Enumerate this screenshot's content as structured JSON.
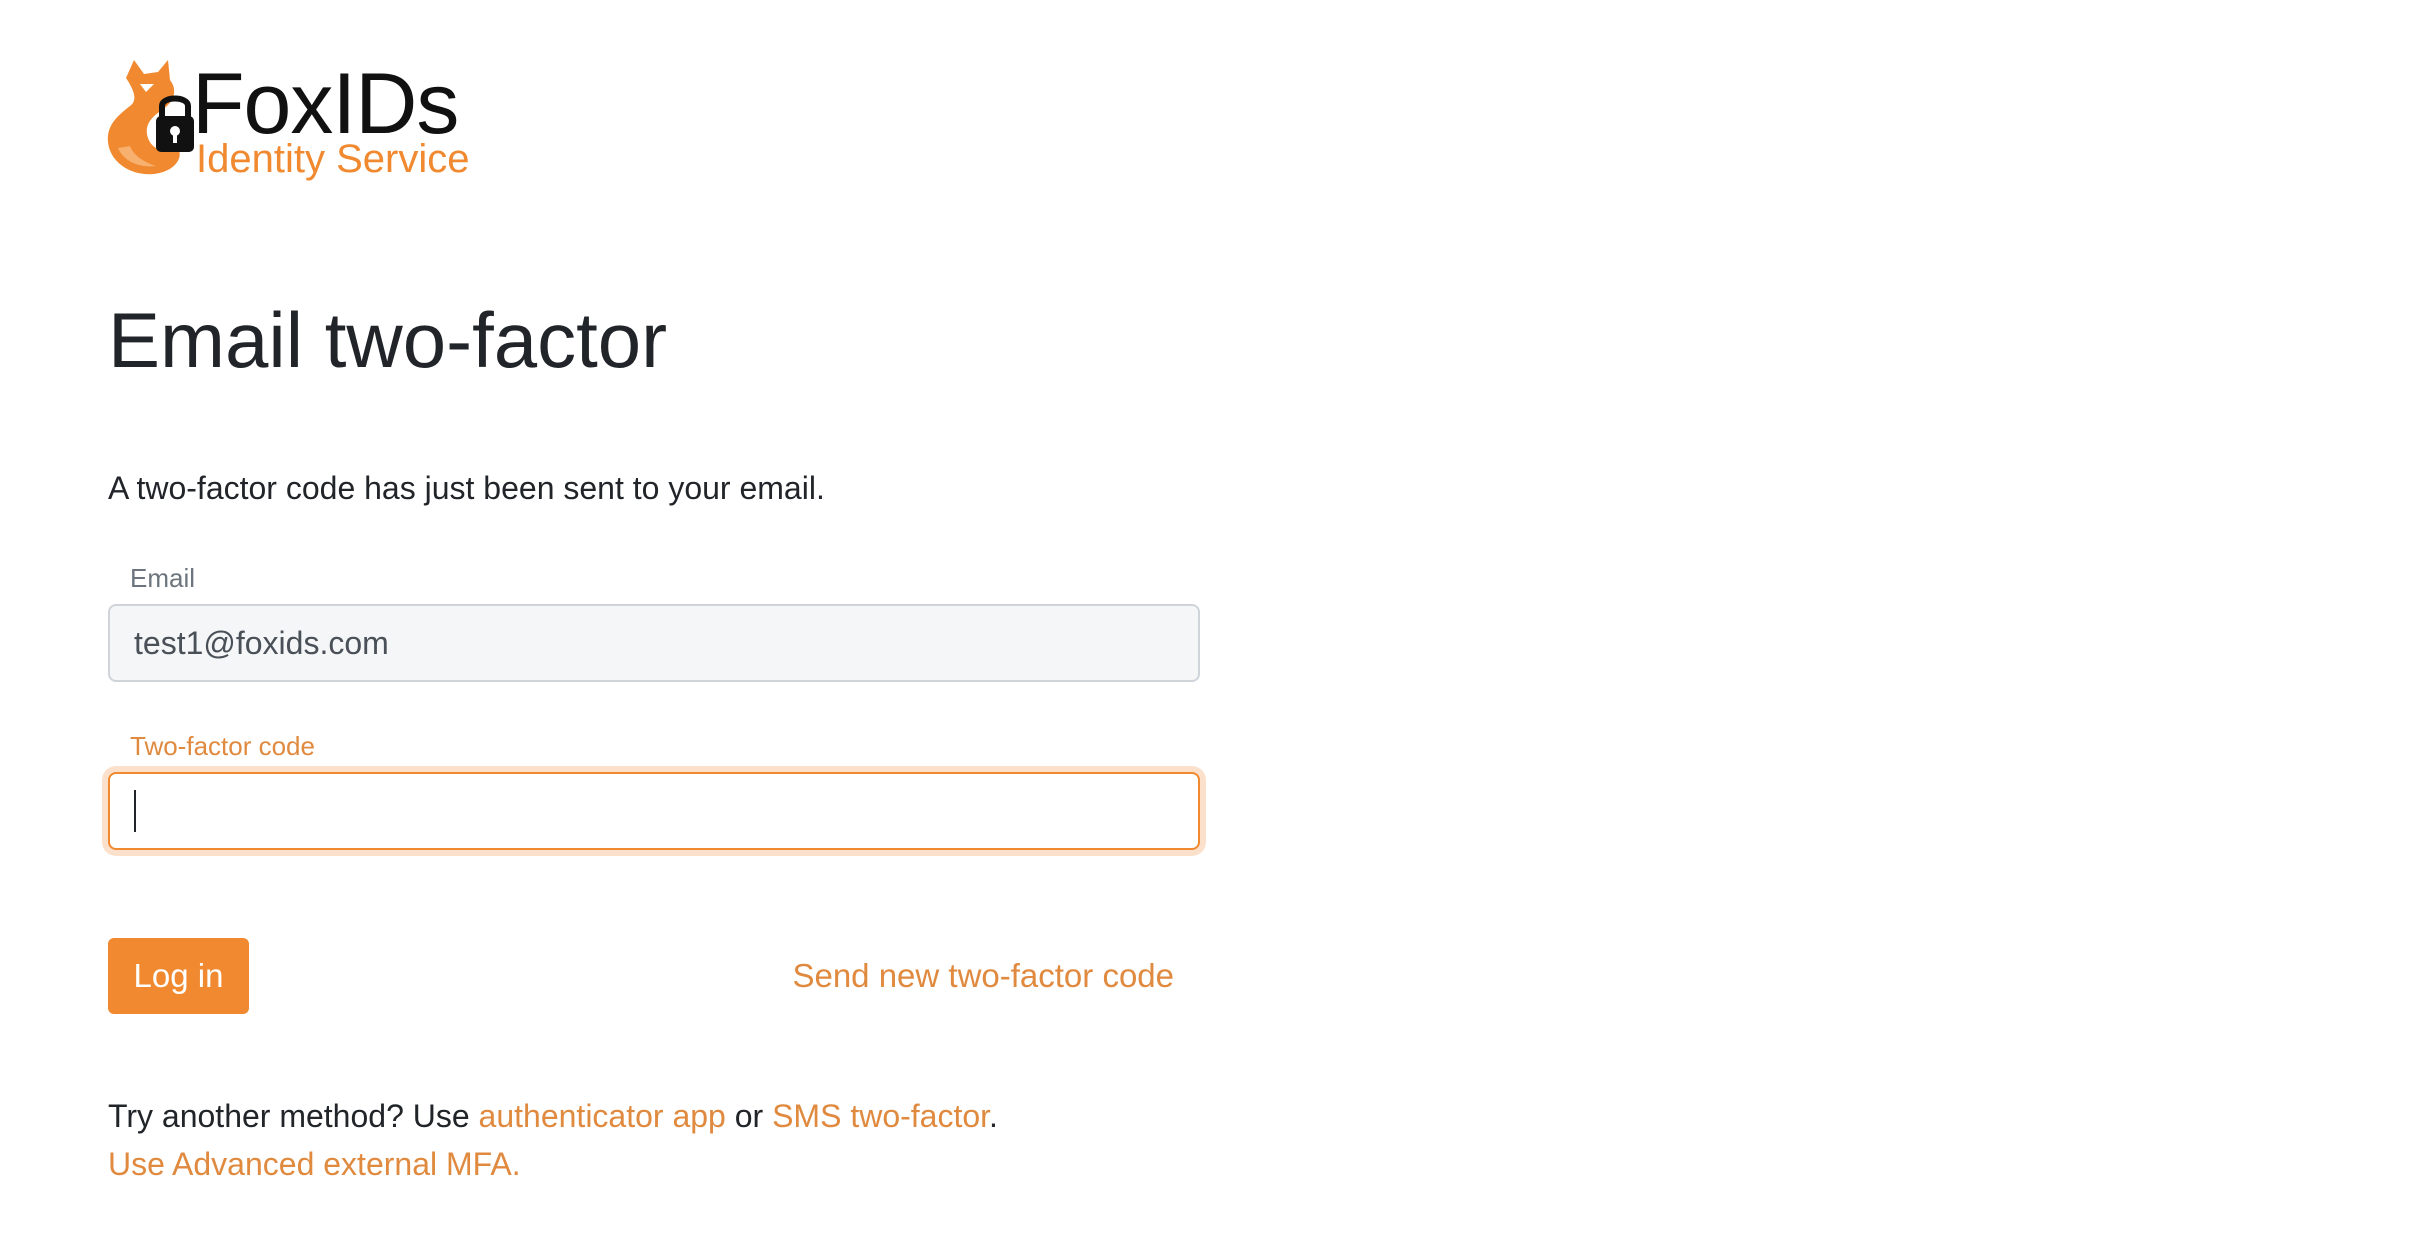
{
  "brand": {
    "name": "FoxIDs",
    "tagline": "Identity Service",
    "logo_icon": "fox-lock-icon",
    "accent_color": "#f0892f"
  },
  "page": {
    "title": "Email two-factor",
    "intro": "A two-factor code has just been sent to your email."
  },
  "form": {
    "email": {
      "label": "Email",
      "value": "test1@foxids.com"
    },
    "code": {
      "label": "Two-factor code",
      "value": ""
    },
    "login_label": "Log in",
    "resend_label": "Send new two-factor code"
  },
  "alternatives": {
    "prefix": "Try another method? Use",
    "authenticator_label": "authenticator app",
    "or_text": "or",
    "sms_label": "SMS two-factor",
    "suffix": ".",
    "external_mfa_label": "Use Advanced external MFA."
  }
}
